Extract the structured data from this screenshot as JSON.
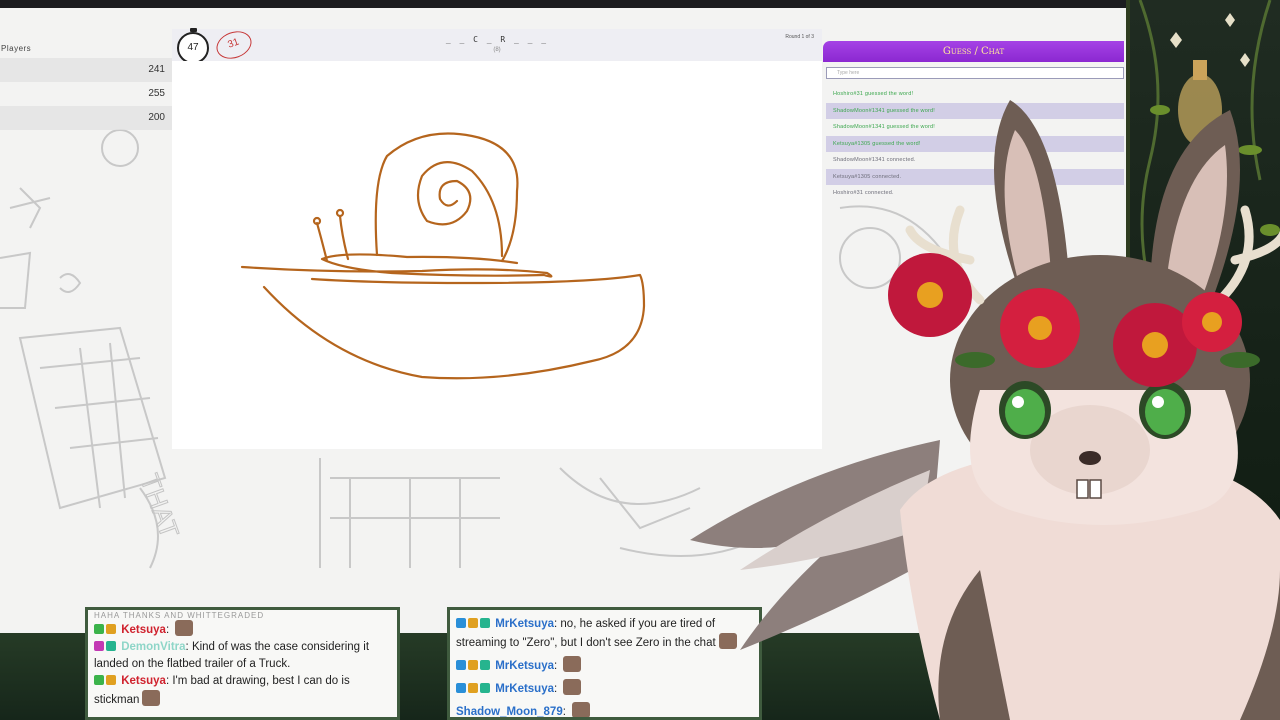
{
  "players": {
    "title": "Players",
    "scores": [
      "241",
      "255",
      "200"
    ]
  },
  "game": {
    "timer": "47",
    "badge": "31",
    "word_hint": "_ _ C _ R _ _ _",
    "word_count": "(8)",
    "round": "Round 1 of 3"
  },
  "guess_panel": {
    "title": "Guess / Chat",
    "input_placeholder": "Type here",
    "messages": [
      {
        "text": "Hoshiro#31 guessed the word!",
        "kind": "green"
      },
      {
        "text": "ShadowMoon#1341 guessed the word!",
        "kind": "green"
      },
      {
        "text": "ShadowMoon#1341 guessed the word!",
        "kind": "green"
      },
      {
        "text": "Ketsuya#1305 guessed the word!",
        "kind": "green"
      },
      {
        "text": "ShadowMoon#1341 connected.",
        "kind": "grey"
      },
      {
        "text": "Ketsuya#1305 connected.",
        "kind": "grey"
      },
      {
        "text": "Hoshiro#31 connected.",
        "kind": "grey"
      }
    ]
  },
  "stream_chat_left": {
    "faded": "HAHA THANKS AND WHITTEGRADED",
    "messages": [
      {
        "user": "Ketsuya",
        "text": "",
        "user_color": "#d0222e",
        "emote": true
      },
      {
        "user": "DemonVitra",
        "text": "Kind of was the case considering it landed on the flatbed trailer of a Truck.",
        "user_color": "#8fd6c8",
        "emote": false
      },
      {
        "user": "Ketsuya",
        "text": "I'm bad at drawing, best I can do is stickman",
        "user_color": "#d0222e",
        "emote": true
      }
    ]
  },
  "stream_chat_right": {
    "messages": [
      {
        "user": "MrKetsuya",
        "text": "no, he asked if you are tired of streaming to \"Zero\", but I don't see Zero in the chat",
        "user_color": "#2a6fc9",
        "emote": true
      },
      {
        "user": "MrKetsuya",
        "text": "",
        "user_color": "#2a6fc9",
        "emote": true
      },
      {
        "user": "MrKetsuya",
        "text": "",
        "user_color": "#2a6fc9",
        "emote": true
      },
      {
        "user": "Shadow_Moon_879",
        "text": "",
        "user_color": "#2a6fc9",
        "emote": true
      }
    ]
  },
  "colors": {
    "accent_purple": "#9a35dc",
    "stroke_brown": "#b5651d",
    "guess_green": "#3aa64c"
  }
}
